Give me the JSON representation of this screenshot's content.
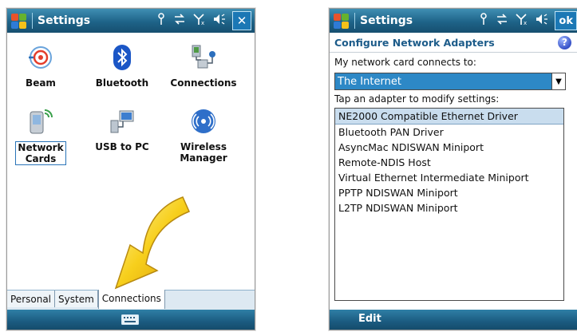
{
  "left": {
    "title": "Settings",
    "close_label": "✕",
    "icons": [
      {
        "name": "beam",
        "label": "Beam"
      },
      {
        "name": "bluetooth",
        "label": "Bluetooth"
      },
      {
        "name": "connections",
        "label": "Connections"
      },
      {
        "name": "network-cards",
        "label": "Network\nCards"
      },
      {
        "name": "usb-to-pc",
        "label": "USB to PC"
      },
      {
        "name": "wireless-manager",
        "label": "Wireless\nManager"
      }
    ],
    "tabs": {
      "personal": "Personal",
      "system": "System",
      "connections": "Connections"
    }
  },
  "right": {
    "title": "Settings",
    "ok_label": "ok",
    "page_title": "Configure Network Adapters",
    "help_label": "?",
    "connects_label": "My network card connects to:",
    "connects_value": "The Internet",
    "tap_label": "Tap an adapter to modify settings:",
    "adapters": [
      "NE2000 Compatible Ethernet Driver",
      "Bluetooth PAN Driver",
      "AsyncMac NDISWAN Miniport",
      "Remote-NDIS Host",
      "Virtual Ethernet Intermediate Miniport",
      "PPTP NDISWAN Miniport",
      "L2TP NDISWAN Miniport"
    ],
    "softkey_left": "Edit"
  },
  "icons": {
    "start": "windows-flag-icon",
    "status": [
      "antenna-icon",
      "sync-arrows-icon",
      "signal-bars-icon",
      "speaker-icon"
    ],
    "keyboard": "keyboard-icon"
  },
  "colors": {
    "titlebar": "#1e6388",
    "accent": "#2d88c6",
    "selection": "#c9ddee",
    "heading": "#1d5c8a"
  }
}
